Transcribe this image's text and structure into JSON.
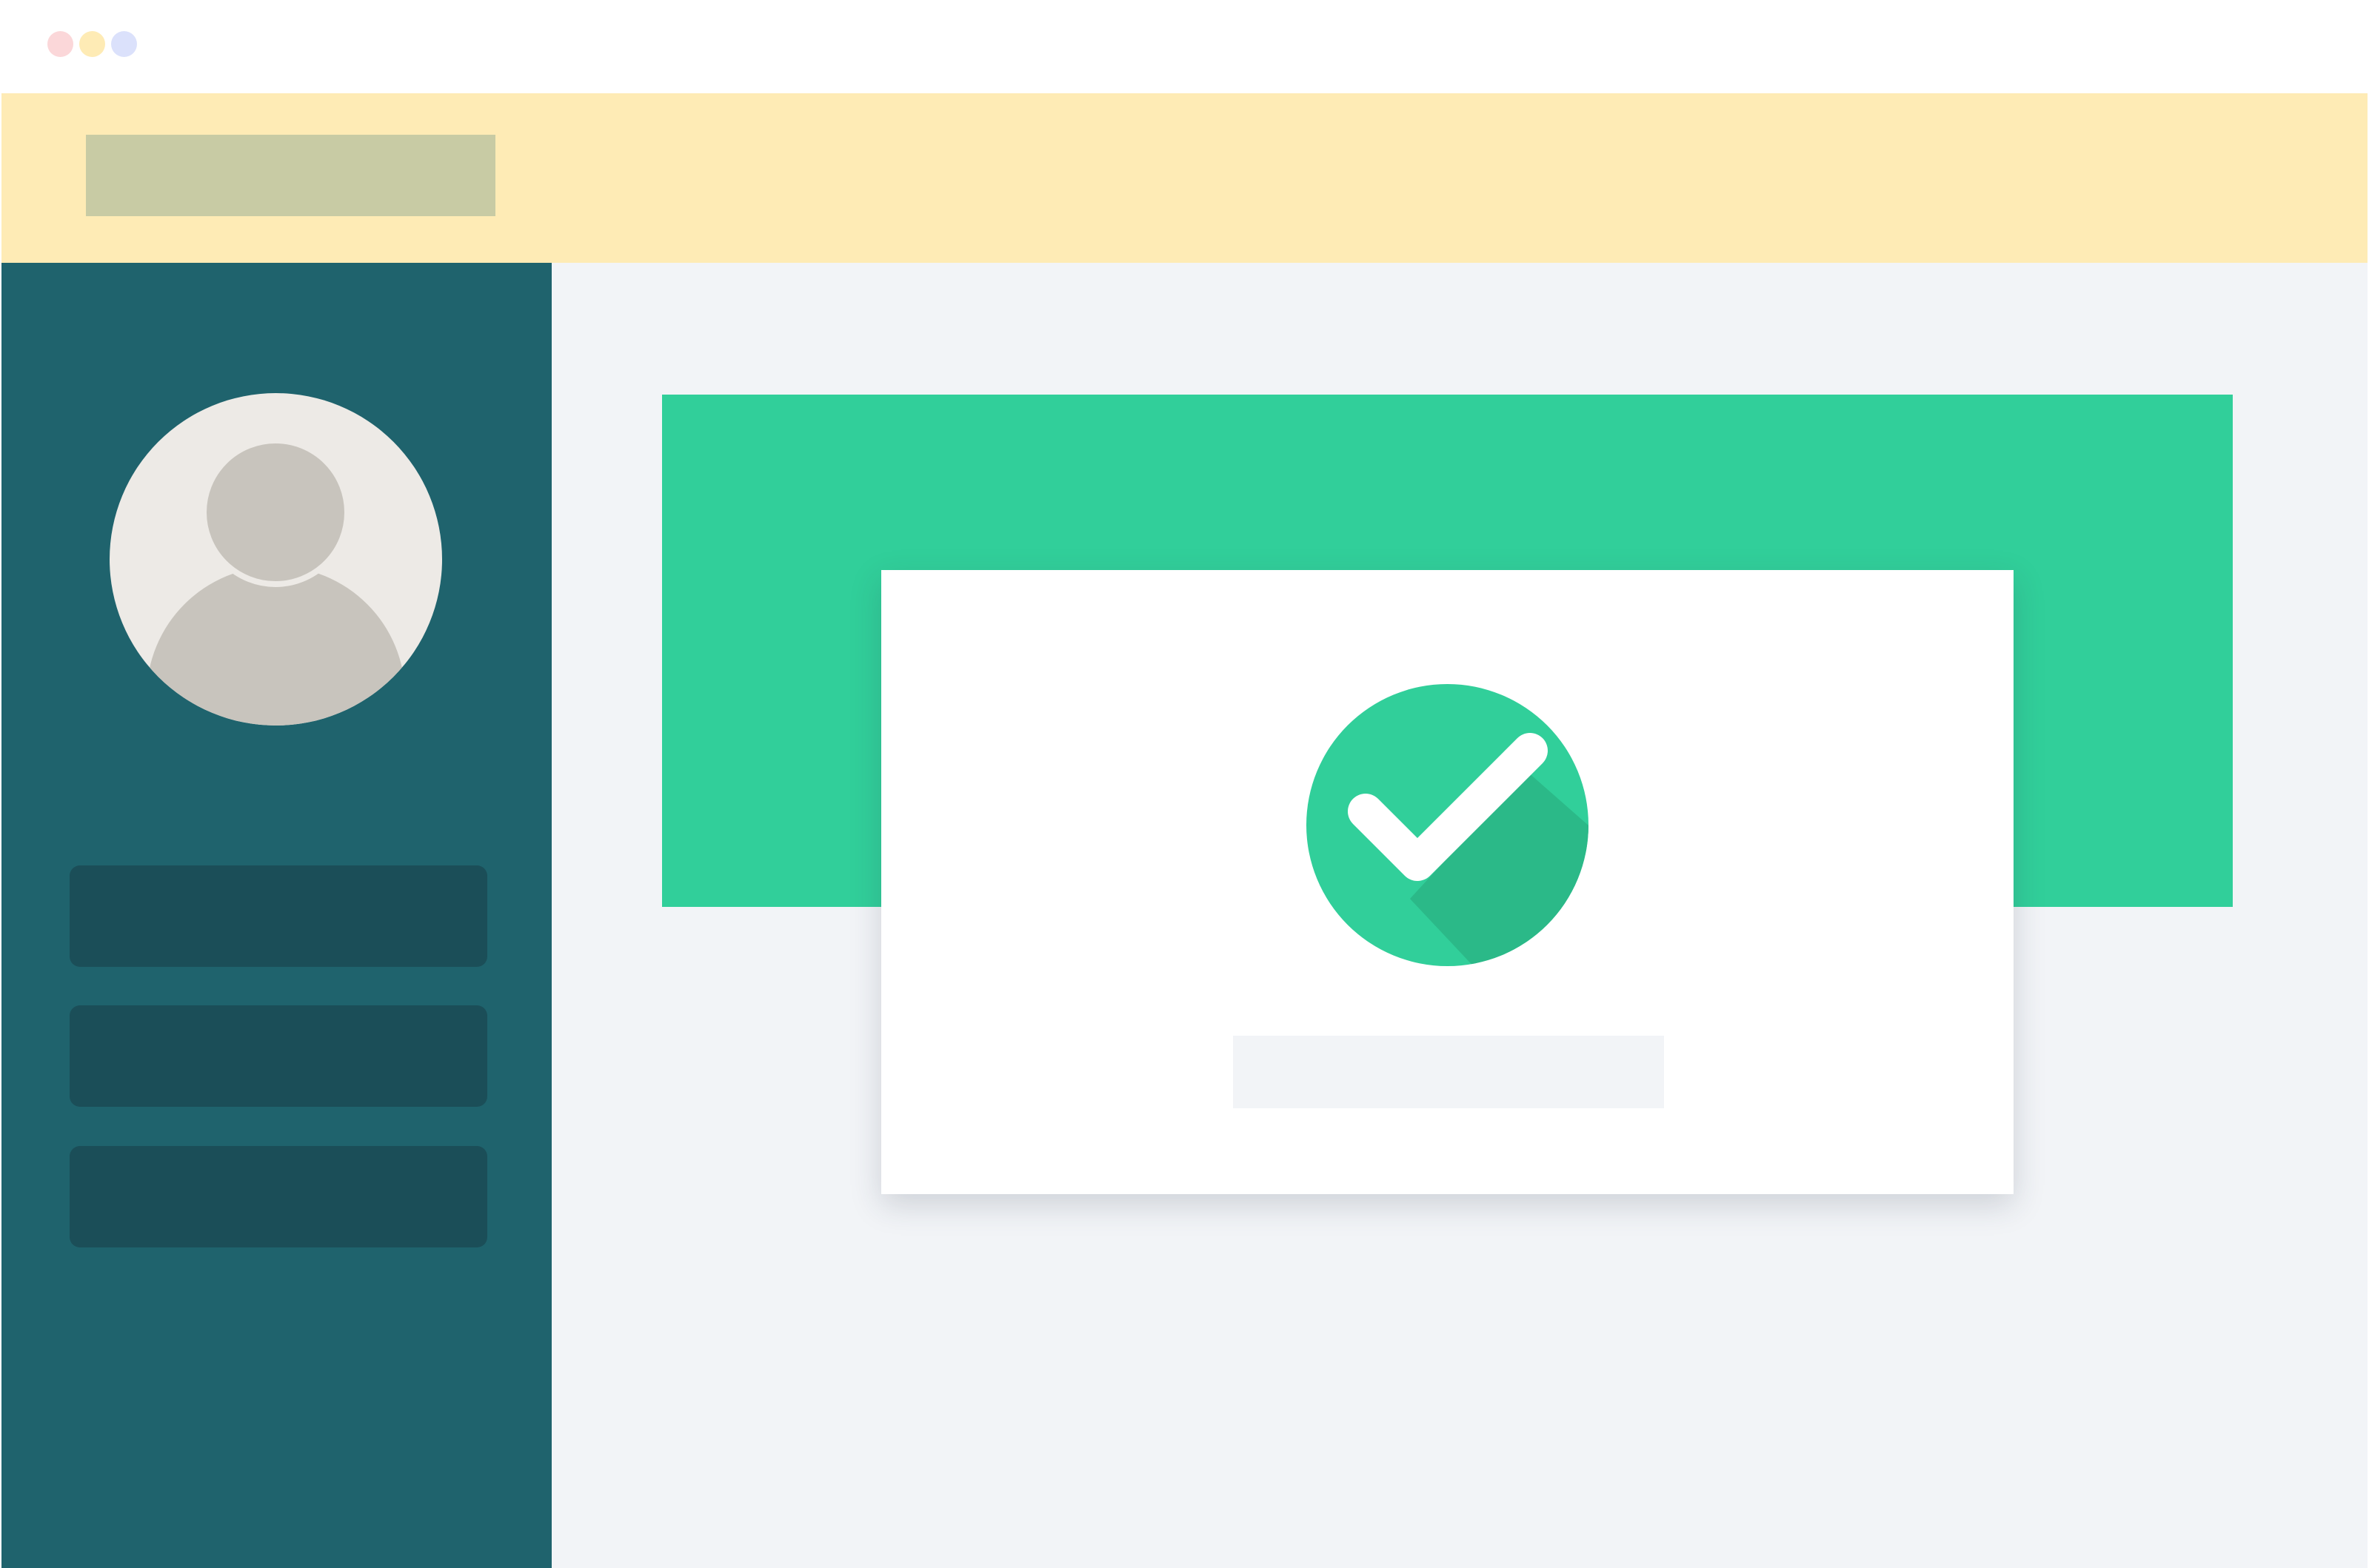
{
  "window": {
    "controls": [
      {
        "name": "close",
        "color": "#fbd7d9"
      },
      {
        "name": "minimize",
        "color": "#feebb5"
      },
      {
        "name": "maximize",
        "color": "#dbe1fb"
      }
    ]
  },
  "header": {
    "background": "#feebb5",
    "logo_color": "#c8cba4"
  },
  "sidebar": {
    "background": "#1f636d",
    "avatar_icon": "user-avatar-icon",
    "items": [
      {
        "icon": "menu-item"
      },
      {
        "icon": "menu-item"
      },
      {
        "icon": "menu-item"
      }
    ]
  },
  "main": {
    "banner_color": "#31cf9a",
    "card": {
      "icon": "check-circle-icon",
      "icon_color": "#31cf9a",
      "status": "success"
    }
  }
}
